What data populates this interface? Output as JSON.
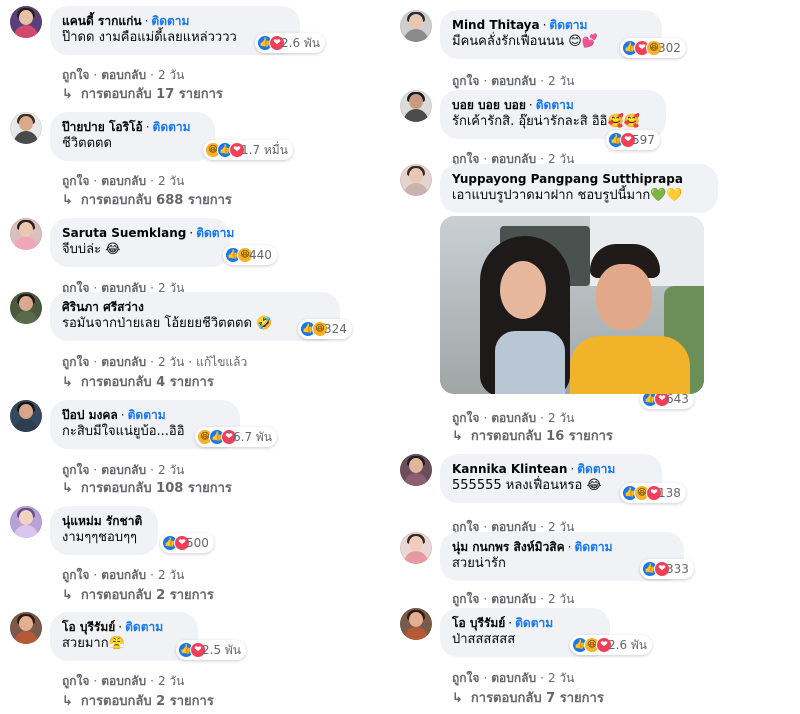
{
  "comments": [
    {
      "name": "แคนดี้ รากแก่น",
      "follow": "ติดตาม",
      "text": "ป๊าดด งามคือแม่ดี้เลยแหล่วววว",
      "reaction_count": "2.6 พัน",
      "reactions": [
        "like",
        "love"
      ],
      "like": "ถูกใจ",
      "reply": "ตอบกลับ",
      "time": "2 วัน",
      "replies": "การตอบกลับ 17 รายการ",
      "avatar": {
        "bg": "#5b3f7a",
        "skin": "#e7c2a8",
        "hair": "#2a1c17",
        "shirt": "#d24a6b"
      }
    },
    {
      "name": "ป๊ายปาย โอริโอ้",
      "follow": "ติดตาม",
      "text": "ชีวิตตตด",
      "reaction_count": "1.7 หมื่น",
      "reactions": [
        "haha",
        "like",
        "love"
      ],
      "like": "ถูกใจ",
      "reply": "ตอบกลับ",
      "time": "2 วัน",
      "replies": "การตอบกลับ 688 รายการ",
      "avatar": {
        "bg": "#e8e8e8",
        "skin": "#d9a98c",
        "hair": "#3b2a22",
        "shirt": "#4a4a4a"
      }
    },
    {
      "name": "Saruta Suemklang",
      "follow": "ติดตาม",
      "text": "จีบบ่ล่ะ 😂",
      "reaction_count": "440",
      "reactions": [
        "like",
        "haha"
      ],
      "like": "ถูกใจ",
      "reply": "ตอบกลับ",
      "time": "2 วัน",
      "avatar": {
        "bg": "#d9c0bc",
        "skin": "#ecc7b3",
        "hair": "#2d1f1b",
        "shirt": "#f0a6b8"
      }
    },
    {
      "name": "ศิรินภา ศรีสว่าง",
      "follow": "",
      "text": "รอมันจากป่ายเลย โอ้ยยยชีวิตตตด 🤣",
      "reaction_count": "324",
      "reactions": [
        "like",
        "haha"
      ],
      "like": "ถูกใจ",
      "reply": "ตอบกลับ",
      "time": "2 วัน",
      "edited": "แก้ไขแล้ว",
      "replies": "การตอบกลับ 4 รายการ",
      "avatar": {
        "bg": "#4b5a3f",
        "skin": "#d8a98e",
        "hair": "#1f1a16",
        "shirt": "#5a6b4a"
      }
    },
    {
      "name": "ป๊อป มงคล",
      "follow": "ติดตาม",
      "text": "กะสิบมีใจแน่ยูบ้อ...อิอิ",
      "reaction_count": "6.7 พัน",
      "reactions": [
        "haha",
        "like",
        "love"
      ],
      "like": "ถูกใจ",
      "reply": "ตอบกลับ",
      "time": "2 วัน",
      "replies": "การตอบกลับ 108 รายการ",
      "avatar": {
        "bg": "#34495e",
        "skin": "#d9a487",
        "hair": "#141414",
        "shirt": "#2d3e50"
      }
    },
    {
      "name": "นุ่แหม่ม รักชาติ",
      "follow": "",
      "text": "งามๆๆชอบๆๆ",
      "reaction_count": "500",
      "reactions": [
        "like",
        "love"
      ],
      "like": "ถูกใจ",
      "reply": "ตอบกลับ",
      "time": "2 วัน",
      "replies": "การตอบกลับ 2 รายการ",
      "avatar": {
        "bg": "#b9a2d6",
        "skin": "#f1d3c2",
        "hair": "#6b4b8a",
        "shirt": "#d9c6ef"
      }
    },
    {
      "name": "โอ บุรีรัมย์",
      "follow": "ติดตาม",
      "text": "สวยมาก😤",
      "reaction_count": "2.5 พัน",
      "reactions": [
        "like",
        "love"
      ],
      "like": "ถูกใจ",
      "reply": "ตอบกลับ",
      "time": "2 วัน",
      "replies": "การตอบกลับ 2 รายการ",
      "avatar": {
        "bg": "#7a5a4a",
        "skin": "#e2b090",
        "hair": "#2b1a12",
        "shirt": "#b45a3a"
      }
    },
    {
      "name": "Mind Thitaya",
      "follow": "ติดตาม",
      "text": "มีคนคลั่งรักเฟื่อนนน 😊💕",
      "reaction_count": "302",
      "reactions": [
        "like",
        "love",
        "haha"
      ],
      "like": "ถูกใจ",
      "reply": "ตอบกลับ",
      "time": "2 วัน",
      "avatar": {
        "bg": "#cfcfcf",
        "skin": "#e9c6b1",
        "hair": "#2a2a2a",
        "shirt": "#8a8a8a"
      }
    },
    {
      "name": "บอย บอย บอย",
      "follow": "ติดตาม",
      "text": "รักเค้ารักสิ. อุ๊ยน่ารักละสิ อิอิ🥰🥰",
      "reaction_count": "597",
      "reactions": [
        "like",
        "love"
      ],
      "like": "ถูกใจ",
      "reply": "ตอบกลับ",
      "time": "2 วัน",
      "avatar": {
        "bg": "#dcdcdc",
        "skin": "#c89a80",
        "hair": "#1b1b1b",
        "shirt": "#4b4b4b"
      }
    },
    {
      "name": "Yuppayong Pangpang Sutthiprapa",
      "follow": "",
      "text": "เอาแบบรูปวาดมาฝาก ชอบรูปนี้มาก💚💛",
      "reaction_count": "643",
      "reactions": [
        "like",
        "love"
      ],
      "like": "ถูกใจ",
      "reply": "ตอบกลับ",
      "time": "2 วัน",
      "replies": "การตอบกลับ 16 รายการ",
      "avatar": {
        "bg": "#e3d4cf",
        "skin": "#eac6b4",
        "hair": "#3a2a24",
        "shirt": "#c9b3ad"
      }
    },
    {
      "name": "Kannika Klintean",
      "follow": "ติดตาม",
      "text": "555555 หลงเฟื่อนหรอ 😂",
      "reaction_count": "138",
      "reactions": [
        "like",
        "haha",
        "love"
      ],
      "like": "ถูกใจ",
      "reply": "ตอบกลับ",
      "time": "2 วัน",
      "avatar": {
        "bg": "#6a4e5a",
        "skin": "#e0b59c",
        "hair": "#231a1c",
        "shirt": "#8b5e74"
      }
    },
    {
      "name": "นุ่ม กนกพร สิงห์มิวสิค",
      "follow": "ติดตาม",
      "text": "สวยน่ารัก",
      "reaction_count": "333",
      "reactions": [
        "like",
        "love"
      ],
      "like": "ถูกใจ",
      "reply": "ตอบกลับ",
      "time": "2 วัน",
      "avatar": {
        "bg": "#e9d6d6",
        "skin": "#f0cdbb",
        "hair": "#3b2622",
        "shirt": "#e79aa4"
      }
    },
    {
      "name": "โอ บุรีรัมย์",
      "follow": "ติดตาม",
      "text": "ป่าสสสสสส",
      "reaction_count": "2.6 พัน",
      "reactions": [
        "like",
        "haha",
        "love"
      ],
      "like": "ถูกใจ",
      "reply": "ตอบกลับ",
      "time": "2 วัน",
      "replies": "การตอบกลับ 7 รายการ",
      "avatar": {
        "bg": "#7a5a4a",
        "skin": "#e2b090",
        "hair": "#2b1a12",
        "shirt": "#b45a3a"
      }
    }
  ]
}
